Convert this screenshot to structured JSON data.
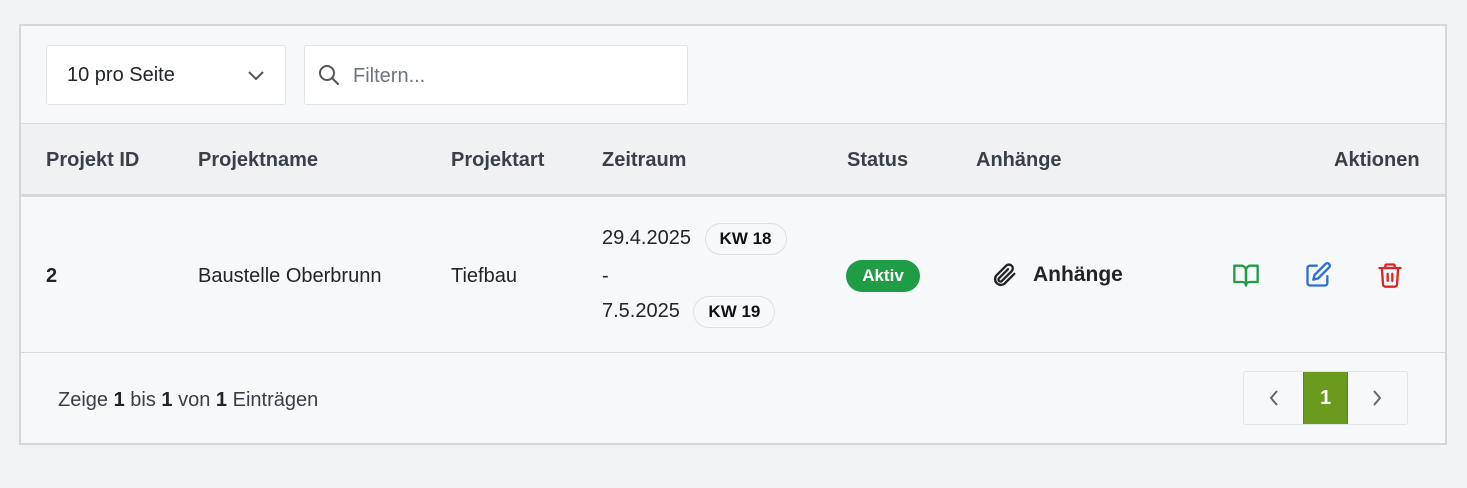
{
  "toolbar": {
    "per_page": "10 pro Seite",
    "filter_placeholder": "Filtern..."
  },
  "table": {
    "headers": {
      "id": "Projekt ID",
      "name": "Projektname",
      "type": "Projektart",
      "period": "Zeitraum",
      "status": "Status",
      "attachments": "Anhänge",
      "actions": "Aktionen"
    },
    "rows": [
      {
        "id": "2",
        "name": "Baustelle Oberbrunn",
        "type": "Tiefbau",
        "start": "29.4.2025",
        "start_week": "KW 18",
        "separator": "-",
        "end": "7.5.2025",
        "end_week": "KW 19",
        "status": "Aktiv",
        "attachments": "Anhänge"
      }
    ]
  },
  "footer": {
    "prefix": "Zeige",
    "from": "1",
    "mid1": "bis",
    "to": "1",
    "mid2": "von",
    "total": "1",
    "suffix": "Einträgen",
    "current_page": "1"
  },
  "colors": {
    "status_active": "#1f9d45",
    "page_current": "#6a9a1e",
    "view_icon": "#1f9d45",
    "edit_icon": "#2f6fdb",
    "delete_icon": "#dc2626"
  }
}
